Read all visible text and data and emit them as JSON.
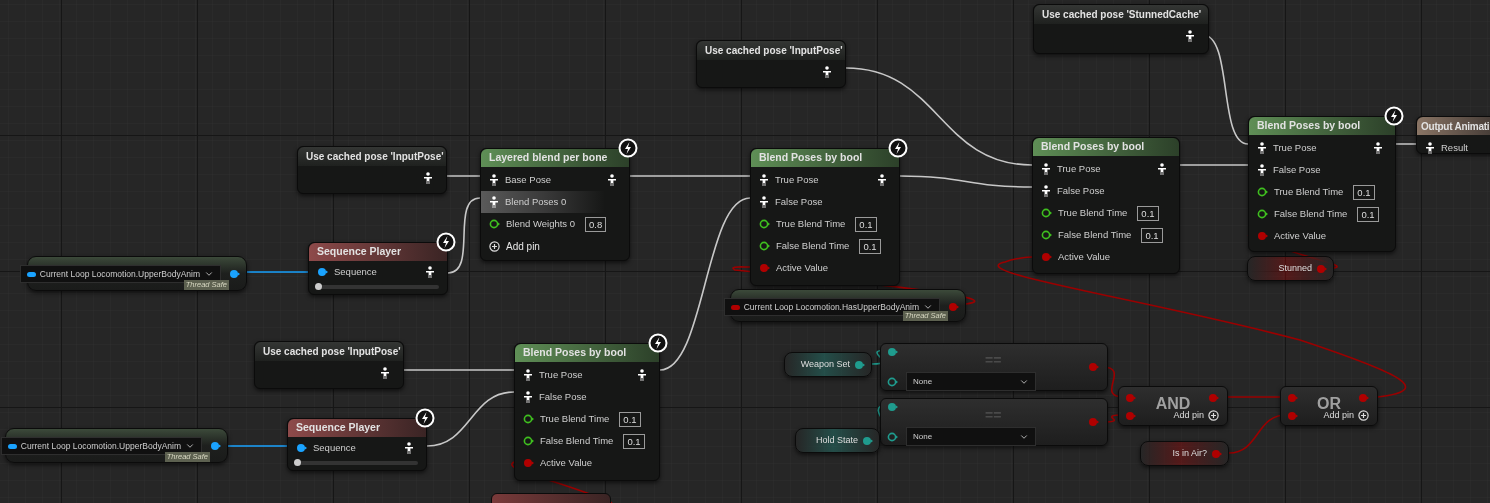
{
  "graph": {
    "nodes": [
      {
        "kind": "cached_pose",
        "title": "Use cached pose 'StunnedCache'"
      },
      {
        "kind": "cached_pose",
        "title": "Use cached pose 'InputPose'"
      },
      {
        "kind": "cached_pose",
        "title": "Use cached pose 'InputPose'"
      },
      {
        "kind": "blend",
        "title": "Layered blend per bone",
        "fast_path": true,
        "pins": [
          {
            "kind": "pose",
            "label": "Base Pose",
            "hovered": false
          },
          {
            "kind": "pose",
            "label": "Blend Poses 0",
            "hovered": true
          },
          {
            "kind": "float",
            "label": "Blend Weights 0",
            "value": "0.8",
            "hovered": false
          },
          {
            "kind": "add",
            "label": "Add pin",
            "hovered": false
          }
        ]
      },
      {
        "kind": "blend",
        "title": "Blend Poses by bool",
        "fast_path": true,
        "pins": [
          {
            "kind": "pose",
            "label": "True Pose"
          },
          {
            "kind": "pose",
            "label": "False Pose"
          },
          {
            "kind": "float",
            "label": "True Blend Time",
            "value": "0.1"
          },
          {
            "kind": "float",
            "label": "False Blend Time",
            "value": "0.1"
          },
          {
            "kind": "bool",
            "label": "Active Value"
          }
        ]
      },
      {
        "kind": "blend",
        "title": "Blend Poses by bool",
        "fast_path": false,
        "pins": [
          {
            "kind": "pose",
            "label": "True Pose"
          },
          {
            "kind": "pose",
            "label": "False Pose"
          },
          {
            "kind": "float",
            "label": "True Blend Time",
            "value": "0.1"
          },
          {
            "kind": "float",
            "label": "False Blend Time",
            "value": "0.1"
          },
          {
            "kind": "bool",
            "label": "Active Value"
          }
        ]
      },
      {
        "kind": "blend",
        "title": "Blend Poses by bool",
        "fast_path": true,
        "pins": [
          {
            "kind": "pose",
            "label": "True Pose"
          },
          {
            "kind": "pose",
            "label": "False Pose"
          },
          {
            "kind": "float",
            "label": "True Blend Time",
            "value": "0.1"
          },
          {
            "kind": "float",
            "label": "False Blend Time",
            "value": "0.1"
          },
          {
            "kind": "bool",
            "label": "Active Value"
          }
        ]
      },
      {
        "kind": "output",
        "title": "Output Animati",
        "pins": [
          {
            "kind": "pose",
            "label": "Result"
          }
        ]
      },
      {
        "kind": "variable",
        "label": "Stunned",
        "color": "#b00000"
      },
      {
        "kind": "property",
        "value": "Current Loop Locomotion.UpperBodyAnim",
        "color": "#1aa3ff",
        "note": "Thread Safe"
      },
      {
        "kind": "sequence_player",
        "title": "Sequence Player",
        "fast_path": true,
        "input": "Sequence",
        "level": 0
      },
      {
        "kind": "cached_pose",
        "title": "Use cached pose 'InputPose'"
      },
      {
        "kind": "blend",
        "title": "Blend Poses by bool",
        "fast_path": true,
        "pins": [
          {
            "kind": "pose",
            "label": "True Pose"
          },
          {
            "kind": "pose",
            "label": "False Pose"
          },
          {
            "kind": "float",
            "label": "True Blend Time",
            "value": "0.1"
          },
          {
            "kind": "float",
            "label": "False Blend Time",
            "value": "0.1"
          },
          {
            "kind": "bool",
            "label": "Active Value"
          }
        ]
      },
      {
        "kind": "sequence_player",
        "title": "Sequence Player",
        "fast_path": true,
        "input": "Sequence",
        "level": 0
      },
      {
        "kind": "property",
        "value": "Current Loop Locomotion.UpperBodyAnim",
        "color": "#1aa3ff",
        "note": "Thread Safe"
      },
      {
        "kind": "property",
        "value": "Current Loop Locomotion.HasUpperBodyAnim",
        "color": "#b00000",
        "note": "Thread Safe"
      },
      {
        "kind": "variable",
        "label": "Weapon Set",
        "color": "#1f9c8e"
      },
      {
        "kind": "compare",
        "operator": "==",
        "value": "None"
      },
      {
        "kind": "compare",
        "operator": "==",
        "value": "None"
      },
      {
        "kind": "variable",
        "label": "Hold State",
        "color": "#1f9c8e"
      },
      {
        "kind": "logic",
        "operator": "AND",
        "add_label": "Add pin"
      },
      {
        "kind": "logic",
        "operator": "OR",
        "add_label": "Add pin"
      },
      {
        "kind": "variable",
        "label": "Is in Air?",
        "color": "#b00000"
      },
      {
        "kind": "fragment"
      }
    ]
  }
}
